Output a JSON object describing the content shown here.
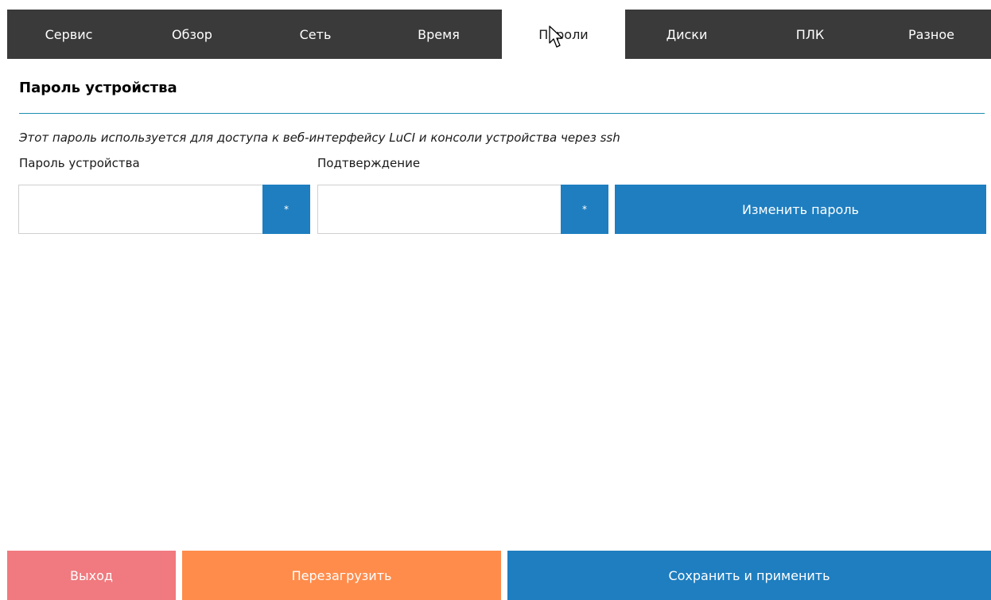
{
  "tabs": [
    {
      "label": "Сервис"
    },
    {
      "label": "Обзор"
    },
    {
      "label": "Сеть"
    },
    {
      "label": "Время"
    },
    {
      "label": "Пароли"
    },
    {
      "label": "Диски"
    },
    {
      "label": "ПЛК"
    },
    {
      "label": "Разное"
    }
  ],
  "active_tab": "Пароли",
  "section": {
    "title": "Пароль устройства",
    "description": "Этот пароль используется для доступа к веб-интерфейсу LuCI и консоли устройства через ssh"
  },
  "password_field": {
    "label": "Пароль устройства",
    "value": "",
    "reveal_label": "*"
  },
  "confirm_field": {
    "label": "Подтверждение",
    "value": "",
    "reveal_label": "*"
  },
  "change_button": {
    "label": "Изменить пароль"
  },
  "footer": {
    "exit_label": "Выход",
    "reboot_label": "Перезагрузить",
    "save_label": "Сохранить и применить"
  },
  "colors": {
    "tabbar_bg": "#3a3a3a",
    "accent_blue": "#1e7ec0",
    "divider": "#1c8fb0",
    "exit": "#f07a7f",
    "reboot": "#ff8c4b"
  },
  "icons": {
    "cursor": "mouse-pointer-icon"
  }
}
